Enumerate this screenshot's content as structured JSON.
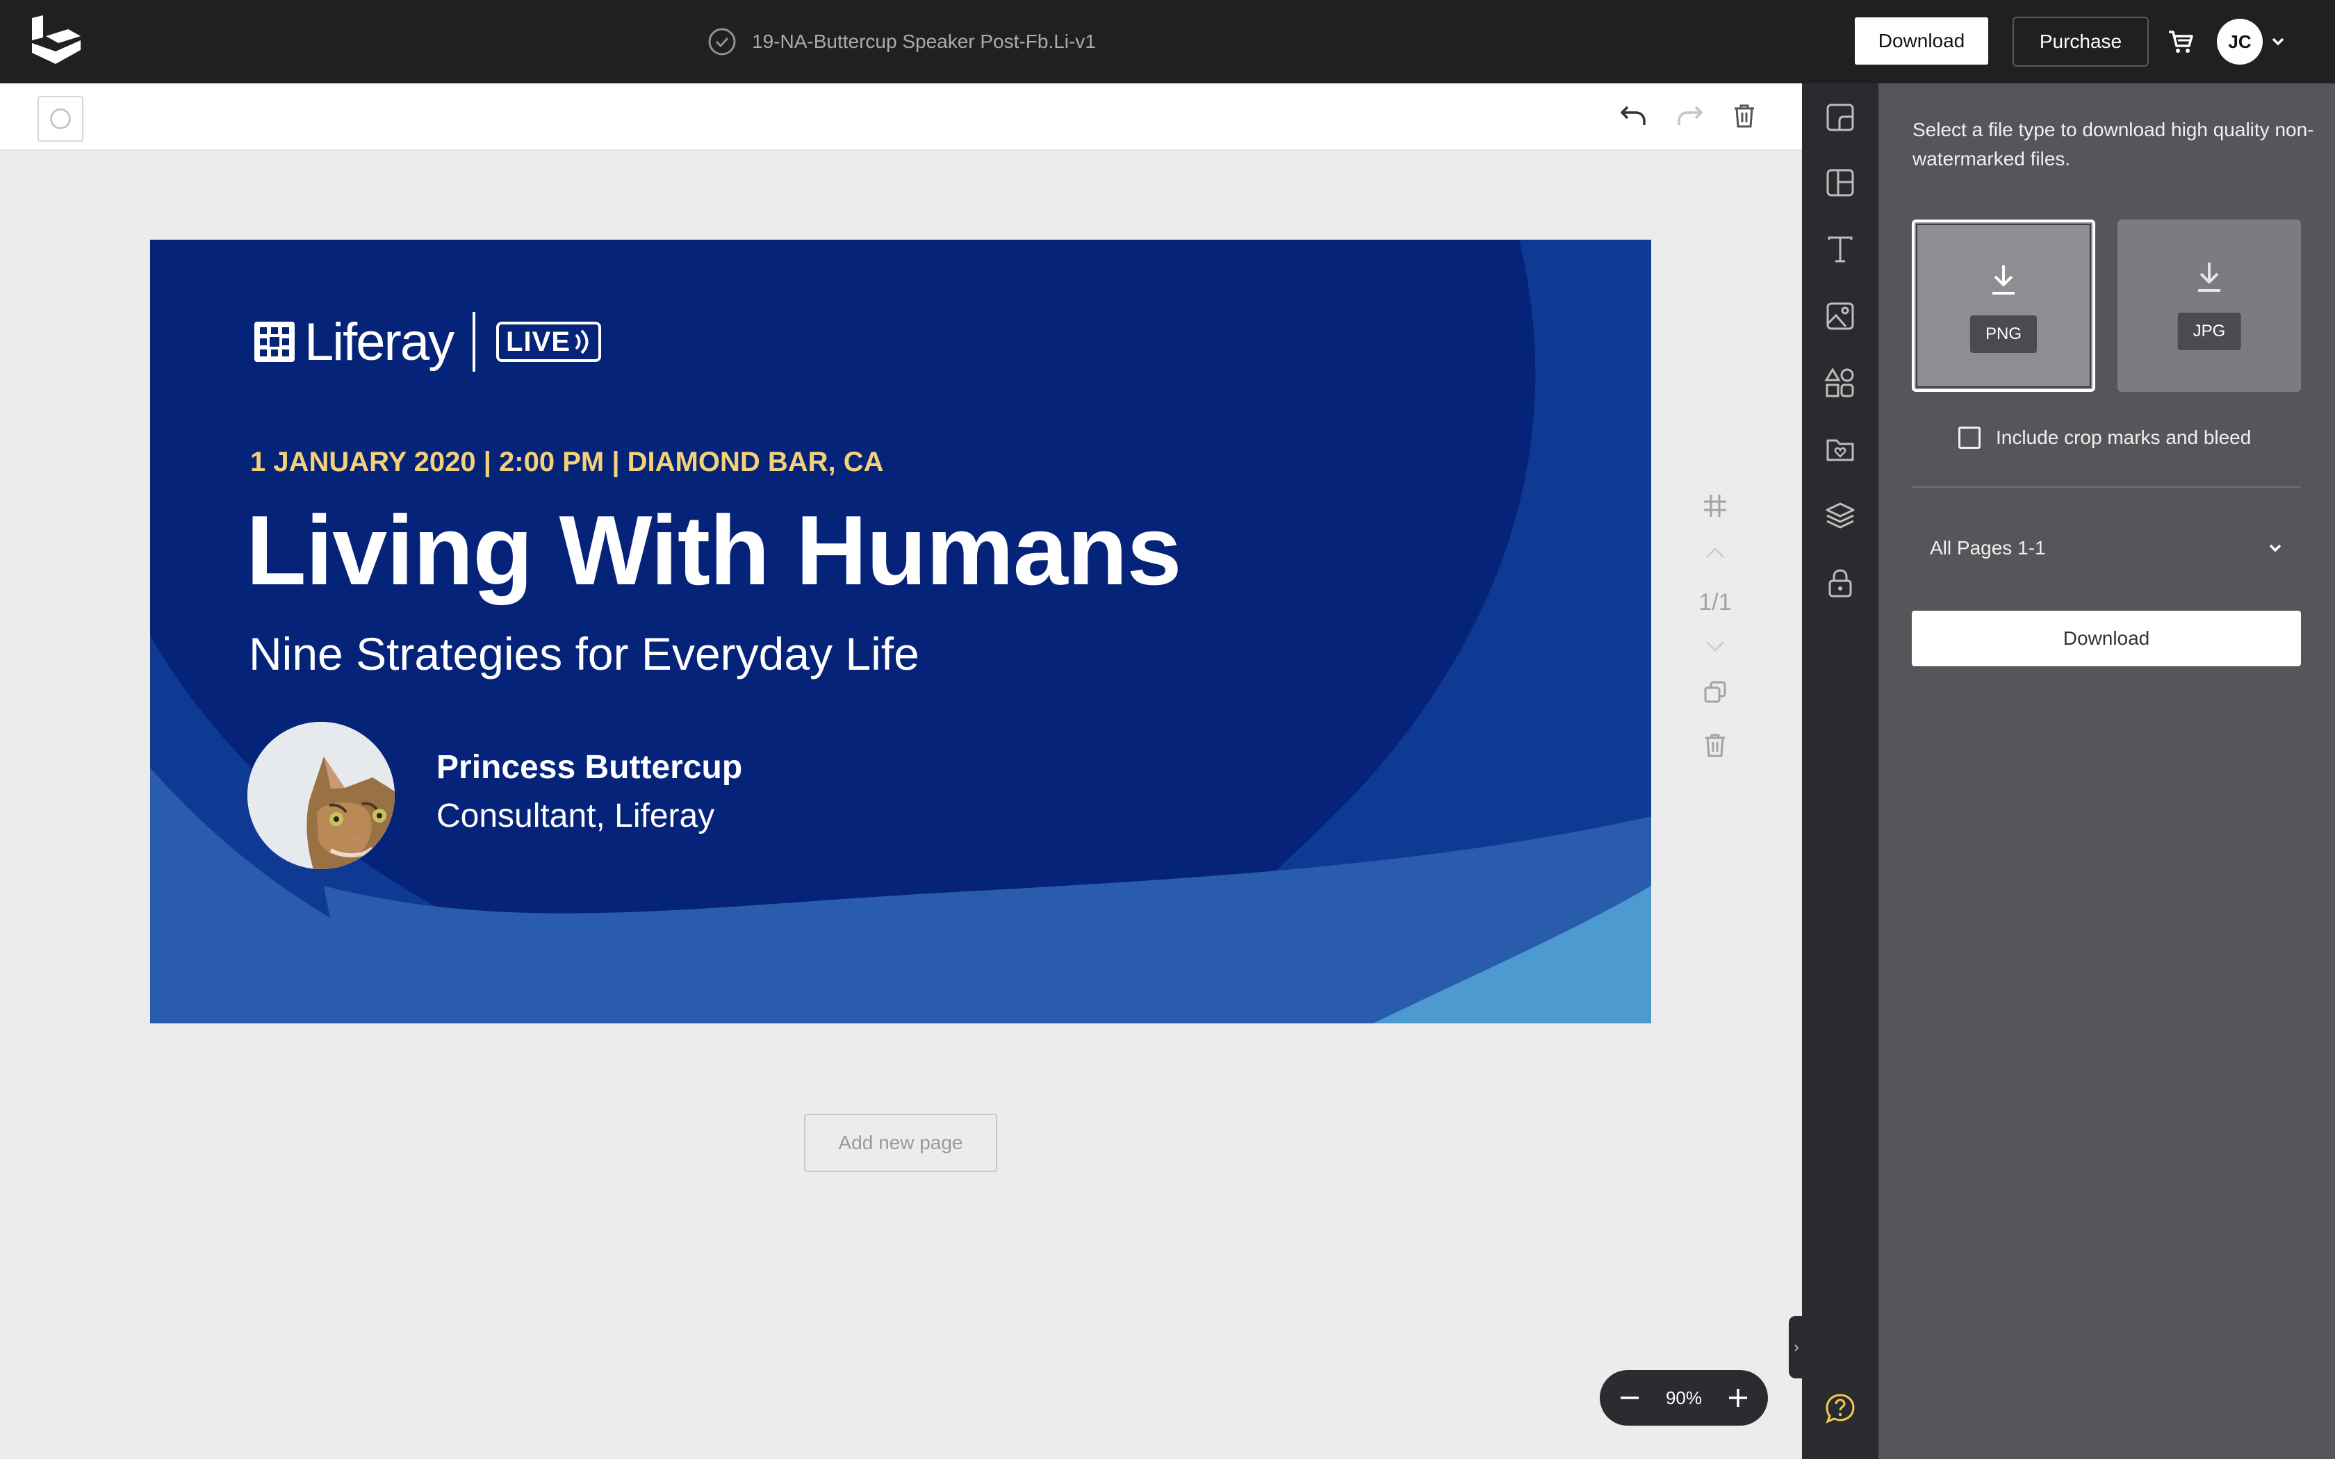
{
  "header": {
    "document_title": "19-NA-Buttercup Speaker Post-Fb.Li-v1",
    "download_label": "Download",
    "purchase_label": "Purchase",
    "user_initials": "JC"
  },
  "slide": {
    "brand_name": "Liferay",
    "brand_tag": "LIVE",
    "event_meta": "1 JANUARY 2020 | 2:00 PM | DIAMOND BAR, CA",
    "headline": "Living With Humans",
    "subhead": "Nine Strategies for Everyday Life",
    "speaker_name": "Princess Buttercup",
    "speaker_role": "Consultant, Liferay",
    "colors": {
      "navy": "#06237a",
      "accent_yellow": "#f5d278",
      "mid_blue": "#2a5cae",
      "light_blue": "#4d9ad0"
    }
  },
  "canvas": {
    "page_counter": "1/1",
    "add_page_label": "Add new page",
    "zoom_level": "90%"
  },
  "rail": {
    "icons": [
      "resize-icon",
      "layout-icon",
      "text-icon",
      "image-icon",
      "shapes-icon",
      "brand-folder-icon",
      "layers-icon",
      "lock-icon",
      "help-icon"
    ]
  },
  "download_panel": {
    "description": "Select a file type to download high quality non-watermarked files.",
    "formats": [
      "PNG",
      "JPG"
    ],
    "selected_format": "PNG",
    "crop_marks_label": "Include crop marks and bleed",
    "crop_marks_checked": false,
    "pages_selected": "All Pages 1-1",
    "download_label": "Download"
  }
}
